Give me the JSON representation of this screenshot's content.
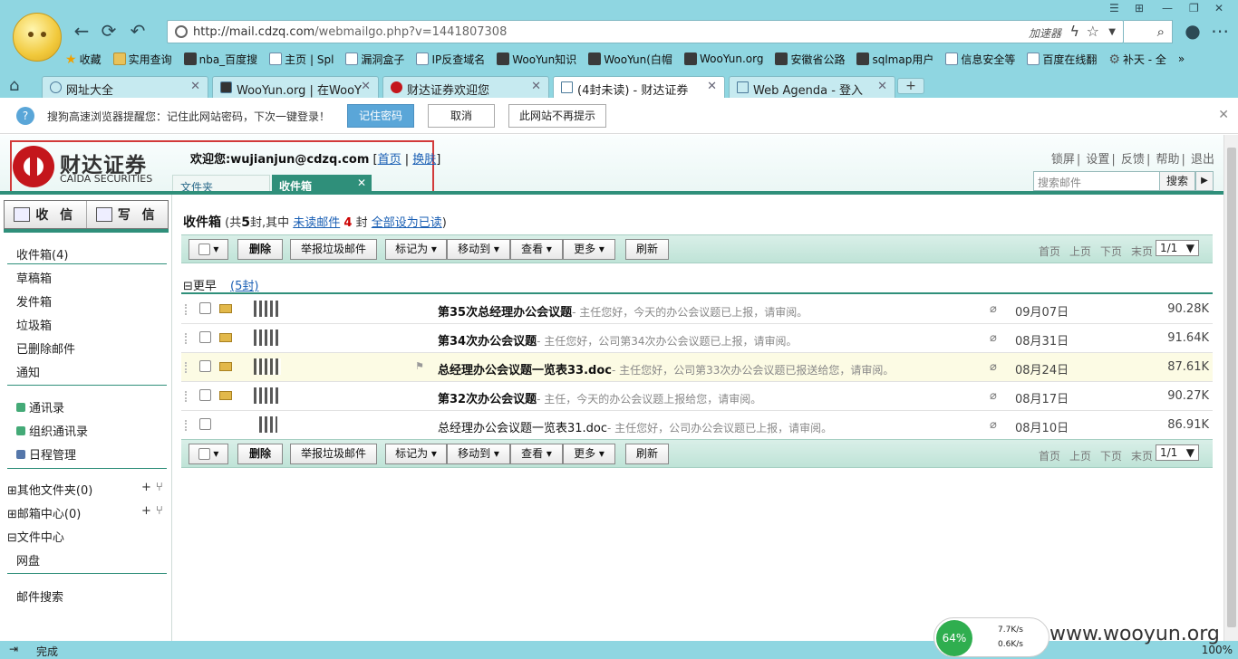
{
  "browser": {
    "url_host": "http://mail.cdzq.com",
    "url_path": "/webmailgo.php?v=1441807308",
    "accelerator": "加速器",
    "bookmarks": [
      "收藏",
      "实用查询",
      "nba_百度搜",
      "主页 | Spl",
      "漏洞盒子",
      "IP反查域名",
      "WooYun知识",
      "WooYun(白帽",
      "WooYun.org",
      "安徽省公路",
      "sqlmap用户",
      "信息安全等",
      "百度在线翻",
      "补天 - 全"
    ],
    "tabs": [
      {
        "title": "网址大全"
      },
      {
        "title": "WooYun.org | 在WooY"
      },
      {
        "title": "财达证券欢迎您"
      },
      {
        "title": "(4封未读) - 财达证券"
      },
      {
        "title": "Web Agenda - 登入"
      }
    ],
    "status": "完成",
    "zoom": "100%",
    "speed": {
      "percent": "64%",
      "up": "7.7K/s",
      "down": "0.6K/s"
    },
    "watermark": "www.wooyun.org"
  },
  "notify": {
    "text": "搜狗高速浏览器提醒您：记住此网站密码，下次一键登录！",
    "remember": "记住密码",
    "cancel": "取消",
    "never": "此网站不再提示"
  },
  "header": {
    "brand_cn": "财达证券",
    "brand_en": "CAIDA SECURITIES",
    "welcome_prefix": "欢迎您:",
    "welcome_user": "wujianjun@cdzq.com",
    "home_link": "首页",
    "skin_link": "换肤",
    "tab_folders": "文件夹",
    "tab_inbox": "收件箱",
    "links": [
      "锁屏",
      "设置",
      "反馈",
      "帮助",
      "退出"
    ],
    "search_placeholder": "搜索邮件",
    "search_btn": "搜索"
  },
  "sidebar": {
    "receive": "收 信",
    "compose": "写 信",
    "folders": [
      "收件箱(4)",
      "草稿箱",
      "发件箱",
      "垃圾箱",
      "已删除邮件",
      "通知"
    ],
    "contacts": [
      "通讯录",
      "组织通讯录",
      "日程管理"
    ],
    "other_folders": "其他文件夹(0)",
    "mail_center": "邮箱中心(0)",
    "file_center": "文件中心",
    "netdisk": "网盘",
    "mail_search": "邮件搜索"
  },
  "content": {
    "title": "收件箱",
    "summary_prefix": "(共",
    "total": "5",
    "summary_mid": "封,其中",
    "unread_link": "未读邮件",
    "unread_count": "4",
    "summary_suffix": "封",
    "mark_all": "全部设为已读",
    "close_paren": ")",
    "toolbar": {
      "delete": "删除",
      "report_spam": "举报垃圾邮件",
      "mark_as": "标记为",
      "move_to": "移动到",
      "view": "查看",
      "more": "更多",
      "refresh": "刷新"
    },
    "pager": [
      "首页",
      "上页",
      "下页",
      "末页"
    ],
    "page": "1/1",
    "group": "更早",
    "group_count": "(5封)",
    "mails": [
      {
        "subject": "第35次总经理办公会议题",
        "preview": "- 主任您好，今天的办公会议题已上报，请审阅。",
        "date": "09月07日",
        "size": "90.28K",
        "unread": true
      },
      {
        "subject": "第34次办公会议题",
        "preview": "- 主任您好，公司第34次办公会议题已上报，请审阅。",
        "date": "08月31日",
        "size": "91.64K",
        "unread": true
      },
      {
        "subject": "总经理办公会议题一览表33.doc",
        "preview": "- 主任您好，公司第33次办公会议题已报送给您，请审阅。",
        "date": "08月24日",
        "size": "87.61K",
        "unread": true
      },
      {
        "subject": "第32次办公会议题",
        "preview": "- 主任，今天的办公会议题上报给您，请审阅。",
        "date": "08月17日",
        "size": "90.27K",
        "unread": true
      },
      {
        "subject": "总经理办公会议题一览表31.doc",
        "preview": "- 主任您好，公司办公会议题已上报，请审阅。",
        "date": "08月10日",
        "size": "86.91K",
        "unread": false
      }
    ]
  }
}
